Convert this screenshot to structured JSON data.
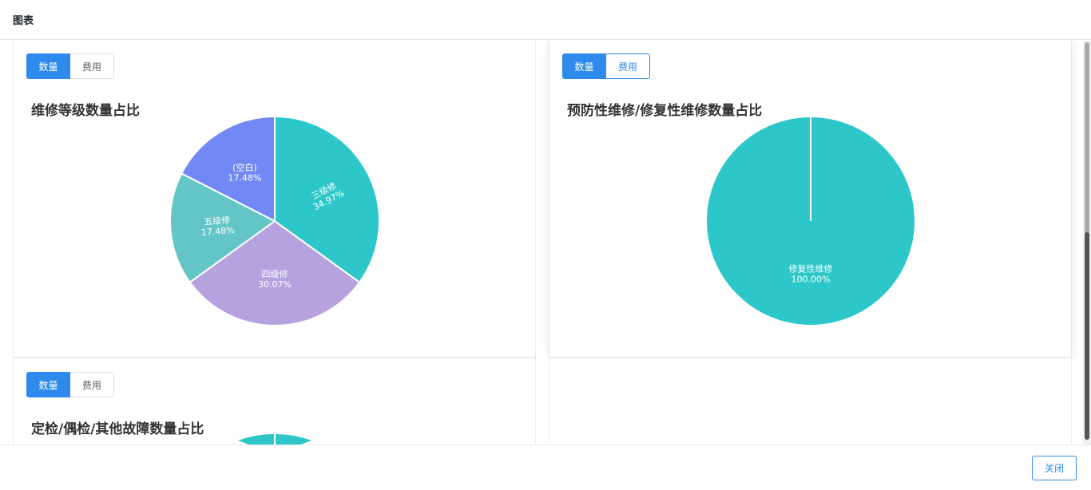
{
  "dialog": {
    "title": "图表",
    "close_label": "关闭"
  },
  "cards": [
    {
      "tabs": {
        "count": "数量",
        "cost": "费用"
      },
      "chart_data": {
        "type": "pie",
        "title": "维修等级数量占比",
        "slices": [
          {
            "label": "三级修",
            "value": 34.97,
            "text": "34.97%",
            "color": "#2ec7c9"
          },
          {
            "label": "四级修",
            "value": 30.07,
            "text": "30.07%",
            "color": "#b6a2de"
          },
          {
            "label": "五级修",
            "value": 17.48,
            "text": "17.48%",
            "color": "#63c5c5"
          },
          {
            "label": "(空白)",
            "value": 17.48,
            "text": "17.48%",
            "color": "#7289f5"
          }
        ]
      }
    },
    {
      "tabs": {
        "count": "数量",
        "cost": "费用"
      },
      "chart_data": {
        "type": "pie",
        "title": "预防性维修/修复性维修数量占比",
        "slices": [
          {
            "label": "修复性维修",
            "value": 100.0,
            "text": "100.00%",
            "color": "#2ec7c9"
          }
        ]
      }
    },
    {
      "tabs": {
        "count": "数量",
        "cost": "费用"
      },
      "chart_data": {
        "type": "pie",
        "title": "定检/偶检/其他故障数量占比",
        "slices": []
      }
    }
  ],
  "colors": {
    "primary": "#2e8aec",
    "pie_teal": "#2ec7c9"
  }
}
